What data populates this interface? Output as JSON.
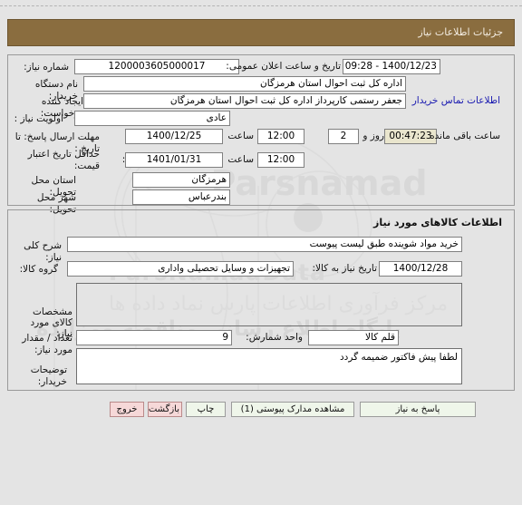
{
  "header": {
    "title": "جزئیات اطلاعات نیاز",
    "bar_color": "#8a6d3f"
  },
  "watermark": {
    "line1": "پایگاه اطلاع رسانی مناقصه ومزایده",
    "line2": "۰۲۱ - ۸۸۳۴۹۶۷۷",
    "line3": "ParsNamadData",
    "line4": "مرکز فرآوری اطلاعات پارس نماد داده ها"
  },
  "request_info": {
    "request_number_label": "شماره نیاز:",
    "request_number_value": "1200003605000017",
    "announce_datetime_label": "تاریخ و ساعت اعلان عمومی:",
    "announce_datetime_value": "1400/12/23 - 09:28",
    "buyer_org_label": "نام دستگاه خریدار:",
    "buyer_org_value": "اداره کل ثبت احوال استان هرمزگان",
    "creator_label": "ایجاد کننده درخواست:",
    "creator_value": "جعفر رستمی کارپرداز اداره کل ثبت احوال استان هرمزگان",
    "buyer_contact_link": "اطلاعات تماس خریدار",
    "priority_label": "اولویت نیاز :",
    "priority_value": "عادی",
    "response_deadline_label": "مهلت ارسال پاسخ: تا تاریخ :",
    "response_deadline_date": "1400/12/25",
    "response_deadline_hour_label": "ساعت",
    "response_deadline_hour": "12:00",
    "remaining_days": "2",
    "remaining_days_label": "روز و",
    "remaining_time": "00:47:23",
    "remaining_suffix_label": "ساعت باقی مانده",
    "price_validity_label": "حداقل تاریخ اعتبار قیمت:",
    "price_validity_until_label": "تا تاریخ :",
    "price_validity_date": "1401/01/31",
    "price_validity_hour_label": "ساعت",
    "price_validity_hour": "12:00",
    "province_label": "استان محل تحویل:",
    "province_value": "هرمزگان",
    "city_label": "شهر محل تحویل:",
    "city_value": "بندرعباس"
  },
  "goods_info": {
    "section_title": "اطلاعات کالاهای مورد نیاز",
    "general_desc_label": "شرح کلی نیاز:",
    "general_desc_value": "خرید مواد شوینده طبق لیست پیوست",
    "goods_group_label": "گروه کالا:",
    "goods_group_value": "تجهیزات و وسایل تحصیلی واداری",
    "need_date_label": "تاریخ نیاز به کالا:",
    "need_date_value": "1400/12/28",
    "specs_label": "مشخصات کالای مورد نیاز:",
    "specs_value": "",
    "quantity_label": "تعداد / مقدار مورد نیاز:",
    "quantity_value": "9",
    "unit_label": "واحد شمارش:",
    "unit_value": "قلم کالا",
    "buyer_notes_label": "توضیحات خریدار:",
    "buyer_notes_value": "لطفا پیش فاکتور ضمیمه گردد"
  },
  "buttons": {
    "respond": "پاسخ به نیاز",
    "view_attachments": "مشاهده مدارک پیوستی (1)",
    "print": "چاپ",
    "back": "بازگشت",
    "exit": "خروج"
  }
}
